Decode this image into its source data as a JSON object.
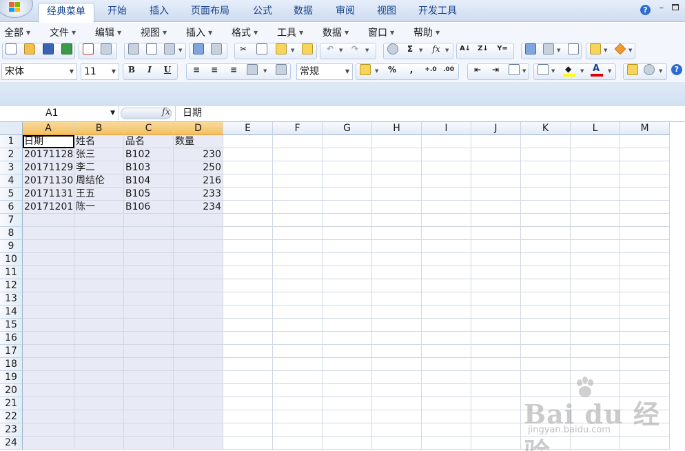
{
  "ribbon": {
    "tabs": [
      "经典菜单",
      "开始",
      "插入",
      "页面布局",
      "公式",
      "数据",
      "审阅",
      "视图",
      "开发工具"
    ],
    "help_glyph": "?",
    "minimize_glyph": "–"
  },
  "menubar": {
    "items": [
      "全部",
      "文件",
      "编辑",
      "视图",
      "插入",
      "格式",
      "工具",
      "数据",
      "窗口",
      "帮助"
    ]
  },
  "toolbar": {
    "font_name": "宋体",
    "font_size": "11",
    "bold_label": "B",
    "italic_label": "I",
    "underline_label": "U",
    "number_format": "常规",
    "percent_label": "%",
    "comma_label": ",",
    "sum_label": "Σ",
    "fx_label": "fx",
    "icons": [
      "new-document-icon",
      "open-folder-icon",
      "save-icon",
      "export-icon",
      "print-preview-icon",
      "print-icon",
      "spell-check-icon",
      "cut-icon",
      "copy-icon",
      "paste-icon",
      "format-painter-icon",
      "undo-icon",
      "redo-icon",
      "sort-ascending-icon",
      "sort-descending-icon",
      "filter-icon",
      "chart-icon",
      "fill-color-icon",
      "font-color-icon",
      "zoom-icon",
      "help-icon"
    ],
    "colors": {
      "fill_color": "#ffff00",
      "font_color": "#e00000",
      "accent": "#15428b"
    }
  },
  "formula_bar": {
    "name_box": "A1",
    "fx_glyph": "fx",
    "content": "日期"
  },
  "sheet": {
    "columns": [
      "A",
      "B",
      "C",
      "D",
      "E",
      "F",
      "G",
      "H",
      "I",
      "J",
      "K",
      "L",
      "M"
    ],
    "rows": [
      "1",
      "2",
      "3",
      "4",
      "5",
      "6",
      "7",
      "8",
      "9",
      "10",
      "11",
      "12",
      "13",
      "14",
      "15",
      "16",
      "17",
      "18",
      "19",
      "20",
      "21",
      "22",
      "23",
      "24"
    ],
    "selected_columns": [
      "A",
      "B",
      "C",
      "D"
    ],
    "data": [
      [
        "日期",
        "姓名",
        "品名",
        "数量"
      ],
      [
        "20171128",
        "张三",
        "B102",
        "230"
      ],
      [
        "20171129",
        "李二",
        "B103",
        "250"
      ],
      [
        "20171130",
        "周结伦",
        "B104",
        "216"
      ],
      [
        "20171131",
        "王五",
        "B105",
        "233"
      ],
      [
        "20171201",
        "陈一",
        "B106",
        "234"
      ]
    ]
  },
  "watermark": {
    "text": "Bai du 经验",
    "url": "jingyan.baidu.com"
  }
}
